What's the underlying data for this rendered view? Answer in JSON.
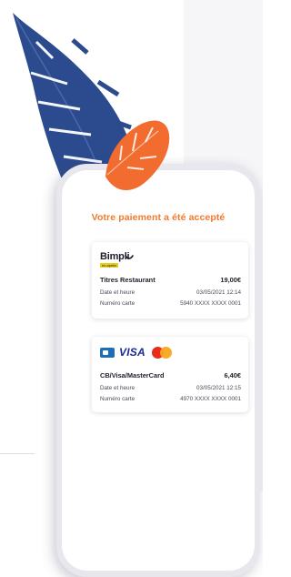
{
  "payment": {
    "status_title": "Votre paiement a été accepté"
  },
  "cards": [
    {
      "logo_name": "Bimpli",
      "logo_tagline": "ex-apetiz",
      "method": "Titres Restaurant",
      "amount": "19,00€",
      "date_label": "Date et heure",
      "date_value": "03/05/2021 12:14",
      "card_label": "Numéro carte",
      "card_value": "5940 XXXX XXXX 0001"
    },
    {
      "logo_name": "VISA",
      "method": "CB/Visa/MasterCard",
      "amount": "6,40€",
      "date_label": "Date et heure",
      "date_value": "03/05/2021 12:15",
      "card_label": "Numéro carte",
      "card_value": "4970 XXXX XXXX 0001"
    }
  ],
  "colors": {
    "accent_orange": "#f07a2a",
    "leaf_navy": "#2c4b8e",
    "leaf_orange": "#f26b2f",
    "visa_blue": "#1a2a8f",
    "mc_red": "#eb2a1c",
    "mc_yellow": "#f8a51c",
    "cb_blue": "#1c6fb6"
  },
  "icons": {
    "decor_left": "leaf-navy-icon",
    "decor_top": "leaf-orange-icon",
    "cb": "cb-logo-icon",
    "mastercard": "mastercard-logo-icon",
    "bimpli_smile": "smile-icon"
  }
}
